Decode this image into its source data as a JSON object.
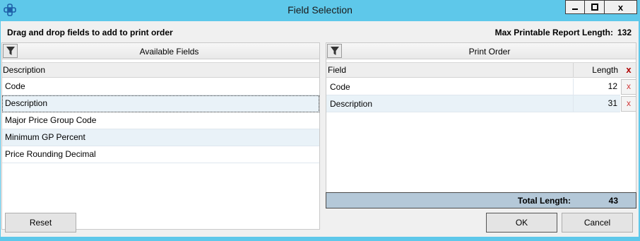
{
  "window": {
    "title": "Field Selection",
    "controls": {
      "minimize": "▁",
      "maximize": "□",
      "close": "x"
    }
  },
  "instruction": "Drag and drop fields to add to print order",
  "max_length": {
    "label": "Max Printable Report Length:",
    "value": "132"
  },
  "available": {
    "title": "Available Fields",
    "column": "Description",
    "rows": [
      "Code",
      "Description",
      "Major Price Group Code",
      "Minimum GP Percent",
      "Price Rounding Decimal"
    ],
    "selected_index": 1
  },
  "print_order": {
    "title": "Print Order",
    "col_field": "Field",
    "col_length": "Length",
    "col_delete": "x",
    "rows": [
      {
        "field": "Code",
        "length": "12",
        "delete": "x"
      },
      {
        "field": "Description",
        "length": "31",
        "delete": "x"
      }
    ],
    "total_label": "Total Length:",
    "total_value": "43"
  },
  "buttons": {
    "reset": "Reset",
    "ok": "OK",
    "cancel": "Cancel"
  },
  "colors": {
    "title_bar": "#5ec8ea",
    "alt_row": "#e9f2f8",
    "total_bar": "#b4c8d8",
    "delete_x": "#d23a3a"
  }
}
